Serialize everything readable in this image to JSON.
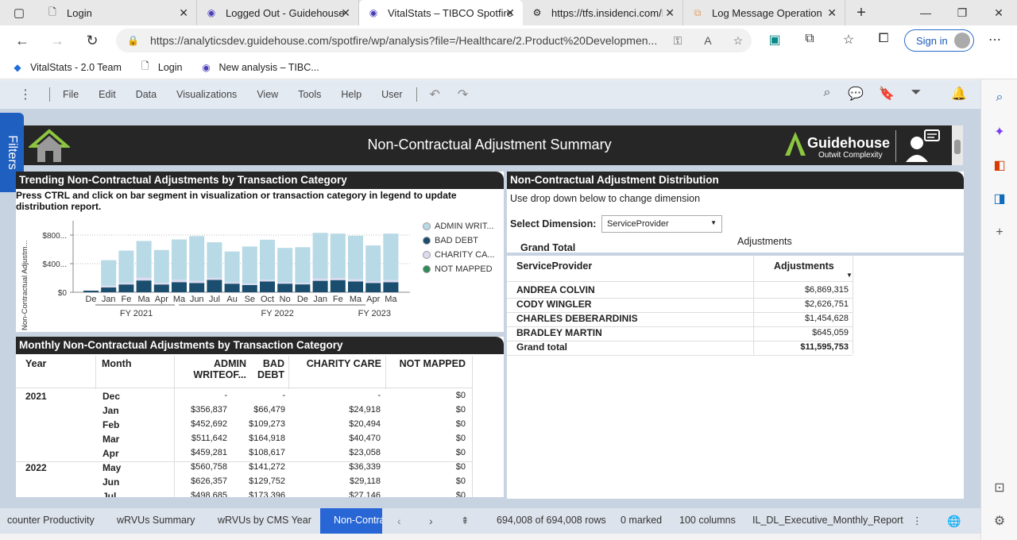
{
  "browser": {
    "tabs": [
      {
        "label": "Login",
        "icon": "document-icon",
        "active": false
      },
      {
        "label": "Logged Out - Guidehouse",
        "icon": "spotfire-icon",
        "active": false
      },
      {
        "label": "VitalStats – TIBCO Spotfire",
        "icon": "spotfire-icon",
        "active": true
      },
      {
        "label": "https://tfs.insidenci.com/D",
        "icon": "devops-icon",
        "active": false
      },
      {
        "label": "Log Message Operation |",
        "icon": "puzzle-icon",
        "active": false
      }
    ],
    "url": "https://analyticsdev.guidehouse.com/spotfire/wp/analysis?file=/Healthcare/2.Product%20Developmen...",
    "sign_in": "Sign in",
    "favorites": [
      {
        "label": "VitalStats - 2.0 Team",
        "icon": "azure-icon"
      },
      {
        "label": "Login",
        "icon": "document-icon"
      },
      {
        "label": "New analysis – TIBC...",
        "icon": "spotfire-icon"
      }
    ]
  },
  "spotfire": {
    "menu": [
      "File",
      "Edit",
      "Data",
      "Visualizations",
      "View",
      "Tools",
      "Help",
      "User"
    ],
    "filters_label": "Filters"
  },
  "dashboard": {
    "title": "Non-Contractual Adjustment Summary",
    "brand": "Guidehouse",
    "brand_tagline": "Outwit Complexity"
  },
  "trend": {
    "header": "Trending Non-Contractual Adjustments by Transaction Category",
    "instruction": "Press CTRL and click on bar segment in visualization or transaction category in legend to update distribution report.",
    "legend": [
      {
        "label": "ADMIN WRIT...",
        "color": "#b8d9e6"
      },
      {
        "label": "BAD DEBT",
        "color": "#1b4d6e"
      },
      {
        "label": "CHARITY CA...",
        "color": "#dcdcf0"
      },
      {
        "label": "NOT MAPPED",
        "color": "#2e8b57"
      }
    ]
  },
  "chart_data": {
    "type": "bar",
    "stacked": true,
    "ylabel": "Non-Contractual Adjustm...",
    "y_ticks": [
      "$0",
      "$400...",
      "$800..."
    ],
    "ylim": [
      0,
      1000000
    ],
    "month_labels": [
      "De",
      "Jan",
      "Fe",
      "Ma",
      "Apr",
      "Ma",
      "Jun",
      "Jul",
      "Au",
      "Se",
      "Oct",
      "No",
      "De",
      "Jan",
      "Fe",
      "Ma",
      "Apr",
      "Ma"
    ],
    "fiscal_labels": [
      {
        "label": "FY 2021",
        "at": 3
      },
      {
        "label": "FY 2022",
        "at": 11
      },
      {
        "label": "FY 2023",
        "at": 16.5
      }
    ],
    "series": [
      {
        "name": "ADMIN WRIT...",
        "color": "#b8d9e6",
        "values": [
          0,
          356837,
          452692,
          511642,
          459281,
          560758,
          626357,
          498685,
          430000,
          520000,
          560000,
          480000,
          500000,
          640000,
          620000,
          610000,
          500000,
          650000
        ]
      },
      {
        "name": "BAD DEBT",
        "color": "#1b4d6e",
        "values": [
          0,
          66479,
          109273,
          164918,
          108617,
          141272,
          129752,
          173396,
          120000,
          100000,
          150000,
          120000,
          110000,
          160000,
          170000,
          150000,
          130000,
          140000
        ]
      },
      {
        "name": "CHARITY CA...",
        "color": "#dcdcf0",
        "values": [
          0,
          24918,
          20494,
          40470,
          23058,
          36339,
          29118,
          27146,
          20000,
          20000,
          25000,
          20000,
          20000,
          30000,
          30000,
          30000,
          25000,
          30000
        ]
      }
    ]
  },
  "monthly": {
    "header": "Monthly Non-Contractual Adjustments by Transaction Category",
    "columns": {
      "year": "Year",
      "month": "Month",
      "admin": "ADMIN WRITEOF...",
      "bad": "BAD DEBT",
      "charity": "CHARITY CARE",
      "notmapped": "NOT MAPPED"
    },
    "admin_line1": "ADMIN",
    "admin_line2": "WRITEOF...",
    "bad_line1": "BAD",
    "bad_line2": "DEBT",
    "rows": [
      {
        "year": "2021",
        "month": "Dec",
        "admin": "-",
        "bad": "-",
        "charity": "-",
        "nm": "$0"
      },
      {
        "year": "",
        "month": "Jan",
        "admin": "$356,837",
        "bad": "$66,479",
        "charity": "$24,918",
        "nm": "$0"
      },
      {
        "year": "",
        "month": "Feb",
        "admin": "$452,692",
        "bad": "$109,273",
        "charity": "$20,494",
        "nm": "$0"
      },
      {
        "year": "",
        "month": "Mar",
        "admin": "$511,642",
        "bad": "$164,918",
        "charity": "$40,470",
        "nm": "$0"
      },
      {
        "year": "",
        "month": "Apr",
        "admin": "$459,281",
        "bad": "$108,617",
        "charity": "$23,058",
        "nm": "$0"
      },
      {
        "year": "2022",
        "month": "May",
        "admin": "$560,758",
        "bad": "$141,272",
        "charity": "$36,339",
        "nm": "$0"
      },
      {
        "year": "",
        "month": "Jun",
        "admin": "$626,357",
        "bad": "$129,752",
        "charity": "$29,118",
        "nm": "$0"
      },
      {
        "year": "",
        "month": "Jul",
        "admin": "$498,685",
        "bad": "$173,396",
        "charity": "$27,146",
        "nm": "$0"
      }
    ]
  },
  "distribution": {
    "header": "Non-Contractual Adjustment Distribution",
    "hint": "Use drop down below to change dimension",
    "select_label": "Select Dimension:",
    "select_value": "ServiceProvider",
    "grand_total_label": "Grand Total",
    "adjustments_label": "Adjustments",
    "table_header": {
      "col1": "ServiceProvider",
      "col2": "Adjustments"
    },
    "rows": [
      {
        "name": "ANDREA COLVIN",
        "value": "$6,869,315"
      },
      {
        "name": "CODY WINGLER",
        "value": "$2,626,751"
      },
      {
        "name": "CHARLES DEBERARDINIS",
        "value": "$1,454,628"
      },
      {
        "name": "BRADLEY MARTIN",
        "value": "$645,059"
      },
      {
        "name": "Grand total",
        "value": "$11,595,753"
      }
    ]
  },
  "statusbar": {
    "pages": [
      "counter Productivity",
      "wRVUs Summary",
      "wRVUs by CMS Year",
      "Non-Contra"
    ],
    "rows": "694,008 of 694,008 rows",
    "marked": "0 marked",
    "columns": "100 columns",
    "table": "IL_DL_Executive_Monthly_Report"
  }
}
